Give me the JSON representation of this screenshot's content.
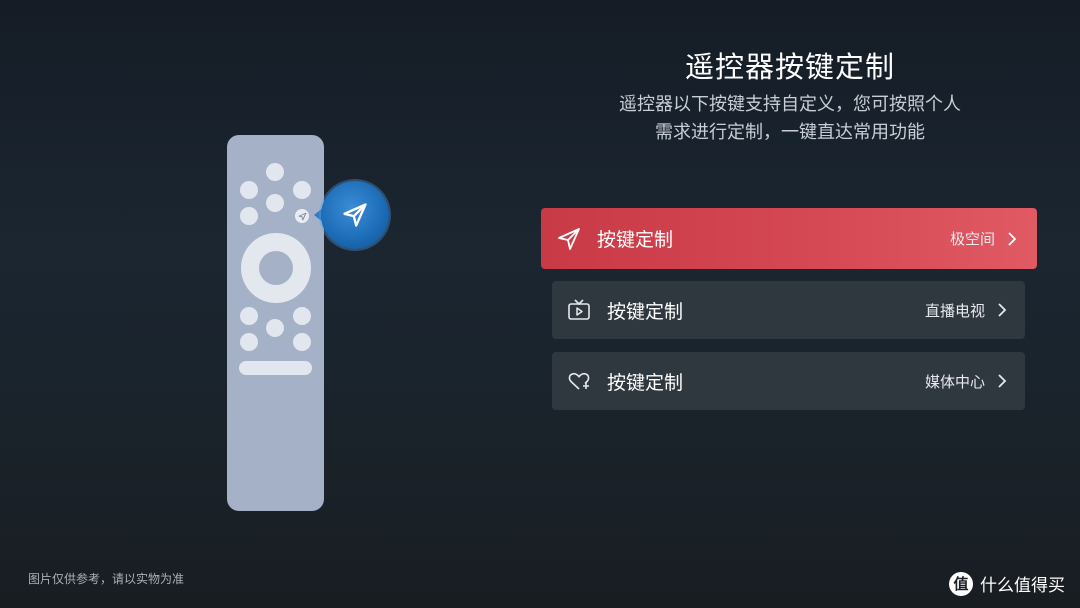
{
  "header": {
    "title": "遥控器按键定制",
    "subtitle_line1": "遥控器以下按键支持自定义，您可按照个人",
    "subtitle_line2": "需求进行定制，一键直达常用功能"
  },
  "menu": {
    "items": [
      {
        "label": "按键定制",
        "value": "极空间",
        "icon": "send-icon",
        "selected": true
      },
      {
        "label": "按键定制",
        "value": "直播电视",
        "icon": "tv-icon",
        "selected": false
      },
      {
        "label": "按键定制",
        "value": "媒体中心",
        "icon": "heart-plus-icon",
        "selected": false
      }
    ]
  },
  "footer": {
    "note": "图片仅供参考，请以实物为准",
    "brand_logo": "值",
    "brand_text": "什么值得买"
  },
  "colors": {
    "selected_bg": "#d2434e",
    "item_bg": "#2f373f",
    "remote_body": "#a5b1c6",
    "bubble": "#1e6db8"
  }
}
